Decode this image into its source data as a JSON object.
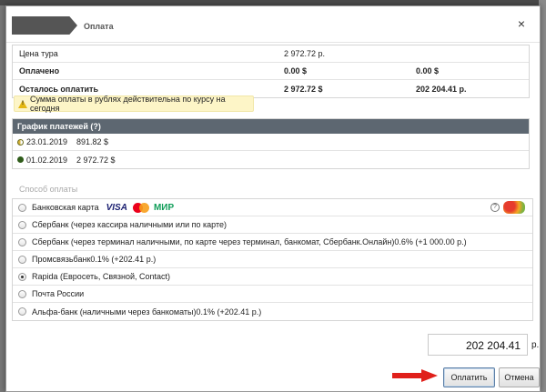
{
  "dialog": {
    "title": "Оплата",
    "close_symbol": "×"
  },
  "summary": {
    "rows": [
      {
        "label": "Цена тура",
        "col2": "2 972.72 р.",
        "col3": "",
        "bold": false
      },
      {
        "label": "Оплачено",
        "col2": "0.00 $",
        "col3": "0.00 $",
        "bold": true
      },
      {
        "label": "Осталось оплатить",
        "col2": "2 972.72 $",
        "col3": "202 204.41 р.",
        "bold": true
      }
    ]
  },
  "notice": {
    "text": "Сумма оплаты в рублях действительна по курсу на сегодня",
    "icon": "warning-icon"
  },
  "schedule": {
    "header": "График платежей (?)",
    "rows": [
      {
        "date": "23.01.2019",
        "amount": "891.82 $",
        "icon": "half-paid-icon"
      },
      {
        "date": "01.02.2019",
        "amount": "2 972.72 $",
        "icon": "full-paid-icon"
      }
    ]
  },
  "payment_methods": {
    "label": "Способ оплаты",
    "items": [
      {
        "label": "Банковская карта",
        "selected": false,
        "logos": [
          "VISA",
          "МИР"
        ]
      },
      {
        "label": "Сбербанк (через кассира наличными или по карте)",
        "selected": false
      },
      {
        "label": "Сбербанк (через терминал наличными, по карте через терминал, банкомат, Сбербанк.Онлайн)0.6% (+1 000.00 р.)",
        "selected": false
      },
      {
        "label": "Промсвязьбанк0.1% (+202.41 р.)",
        "selected": false
      },
      {
        "label": "Rapida (Евросеть, Связной, Contact)",
        "selected": true
      },
      {
        "label": "Почта России",
        "selected": false
      },
      {
        "label": "Альфа-банк (наличными через банкоматы)0.1% (+202.41 р.)",
        "selected": false
      }
    ],
    "help_symbol": "?"
  },
  "amount": {
    "value": "202 204.41",
    "currency": "р."
  },
  "buttons": {
    "pay": "Оплатить",
    "cancel": "Отмена"
  },
  "colors": {
    "schedule_header": "#5d6771",
    "notice_bg": "#fdf5c7",
    "arrow": "#e0201b"
  }
}
